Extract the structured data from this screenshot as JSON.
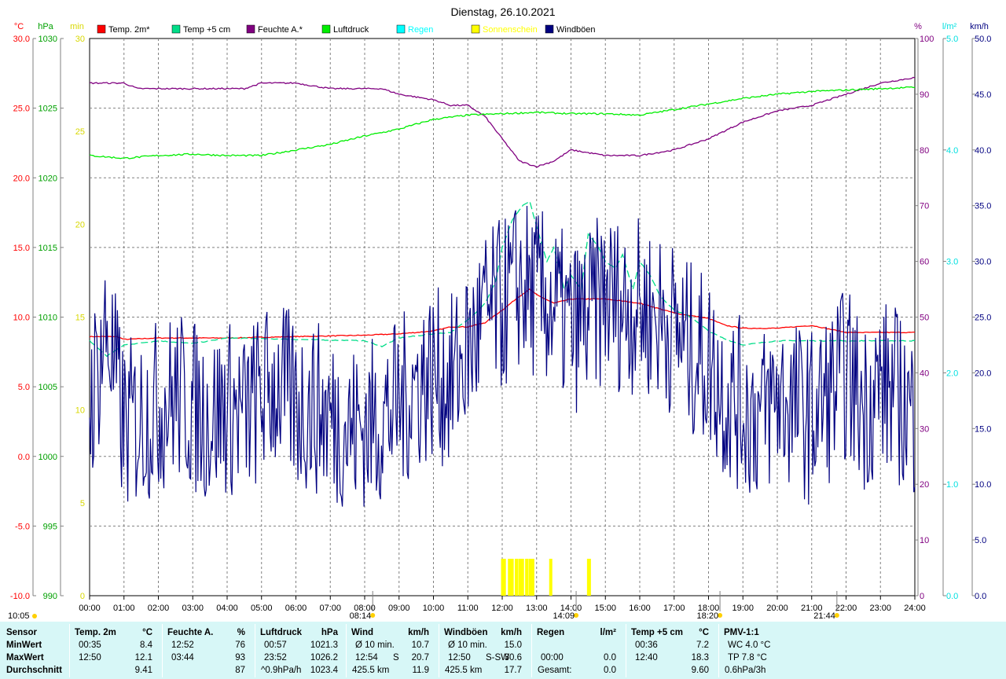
{
  "chart_data": {
    "type": "line",
    "title": "Dienstag, 26.10.2021",
    "x_ticks": [
      "00:00",
      "01:00",
      "02:00",
      "03:00",
      "04:00",
      "05:00",
      "06:00",
      "07:00",
      "08:00",
      "09:00",
      "10:00",
      "11:00",
      "12:00",
      "13:00",
      "14:00",
      "15:00",
      "16:00",
      "17:00",
      "18:00",
      "19:00",
      "20:00",
      "21:00",
      "22:00",
      "23:00",
      "24:00"
    ],
    "xlim": [
      0,
      24
    ],
    "grid": true,
    "legend_position": "top",
    "axes": {
      "temp": {
        "unit": "°C",
        "ylim": [
          -10,
          30
        ],
        "ticks": [
          "30.0",
          "25.0",
          "20.0",
          "15.0",
          "10.0",
          "5.0",
          "0.0",
          "-5.0",
          "-10.0"
        ],
        "color": "#ff0000"
      },
      "pressure": {
        "unit": "hPa",
        "ylim": [
          990,
          1030
        ],
        "ticks": [
          "1030",
          "1025",
          "1020",
          "1015",
          "1010",
          "1005",
          "1000",
          "995",
          "990"
        ],
        "color": "#00a000"
      },
      "sunshine": {
        "unit": "min",
        "ylim": [
          0,
          30
        ],
        "ticks": [
          "30",
          "25",
          "20",
          "15",
          "10",
          "5",
          "0"
        ],
        "color": "#d8d800"
      },
      "humidity": {
        "unit": "%",
        "ylim": [
          0,
          100
        ],
        "ticks": [
          "100",
          "90",
          "80",
          "70",
          "60",
          "50",
          "40",
          "30",
          "20",
          "10",
          "0"
        ],
        "color": "#800080"
      },
      "rain": {
        "unit": "l/m²",
        "ylim": [
          0,
          5
        ],
        "ticks": [
          "5.0",
          "4.0",
          "3.0",
          "2.0",
          "1.0",
          "0.0"
        ],
        "color": "#00e0e0"
      },
      "wind": {
        "unit": "km/h",
        "ylim": [
          0,
          50
        ],
        "ticks": [
          "50.0",
          "45.0",
          "40.0",
          "35.0",
          "30.0",
          "25.0",
          "20.0",
          "15.0",
          "10.0",
          "5.0",
          "0.0"
        ],
        "color": "#000080"
      }
    },
    "series": [
      {
        "name": "Temp. 2m*",
        "color": "#ff0000",
        "axis": "temp",
        "x": [
          0,
          0.8,
          1,
          2,
          4,
          6,
          8,
          9,
          10,
          10.5,
          11,
          11.5,
          12,
          12.5,
          12.8,
          13,
          13.5,
          14,
          15,
          16,
          17,
          17.5,
          18,
          18.5,
          19,
          20,
          21,
          22,
          23,
          24
        ],
        "values": [
          8.6,
          8.6,
          8.4,
          8.5,
          8.5,
          8.6,
          8.7,
          8.8,
          9.0,
          9.3,
          9.3,
          9.6,
          10.5,
          11.5,
          12.0,
          11.6,
          11.0,
          11.3,
          11.3,
          11.0,
          10.3,
          10.1,
          9.9,
          9.4,
          9.2,
          9.2,
          9.4,
          8.9,
          8.9,
          8.9
        ]
      },
      {
        "name": "Temp +5 cm",
        "color": "#00dd88",
        "axis": "temp",
        "dashed": true,
        "x": [
          0,
          0.5,
          1,
          2,
          3,
          4,
          6,
          8,
          8.5,
          9,
          10,
          10.5,
          11,
          11.3,
          11.5,
          11.8,
          12,
          12.3,
          12.6,
          12.8,
          13,
          13.3,
          13.5,
          13.8,
          14,
          14.3,
          14.5,
          14.8,
          15,
          15.3,
          15.5,
          15.8,
          16,
          16.3,
          16.6,
          17,
          17.5,
          18,
          18.5,
          19,
          20,
          21,
          22,
          23,
          24
        ],
        "values": [
          8.3,
          7.2,
          8.0,
          8.3,
          8.1,
          8.5,
          8.4,
          8.3,
          7.9,
          8.5,
          8.8,
          8.9,
          9.8,
          10.5,
          11.0,
          12.5,
          15.0,
          17.0,
          18.0,
          18.3,
          16.5,
          14.0,
          15.0,
          12.0,
          13.0,
          12.0,
          16.0,
          15.0,
          14.0,
          13.5,
          14.5,
          12.0,
          14.0,
          13.0,
          11.5,
          10.5,
          10.0,
          9.0,
          8.4,
          8.0,
          8.3,
          8.3,
          8.3,
          8.3,
          8.3
        ]
      },
      {
        "name": "Feuchte A.*",
        "color": "#800080",
        "axis": "humidity",
        "x": [
          0,
          1,
          1.4,
          3,
          4.5,
          5,
          6,
          7,
          8,
          8.5,
          9,
          10,
          10.5,
          11,
          11.5,
          12,
          12.5,
          13,
          13.5,
          14,
          15,
          16,
          17,
          18,
          19,
          20,
          21,
          22,
          23,
          24
        ],
        "values": [
          92,
          92,
          91,
          91,
          91,
          92,
          92,
          91,
          91,
          91,
          90,
          89,
          88,
          88,
          86,
          82,
          78,
          77,
          78,
          80,
          79,
          79,
          80,
          82,
          85,
          87,
          88,
          90,
          92,
          93
        ]
      },
      {
        "name": "Luftdruck",
        "color": "#00ee00",
        "axis": "pressure",
        "x": [
          0,
          1,
          2,
          3,
          4,
          5,
          6,
          7,
          8,
          9,
          10,
          11,
          12,
          13,
          14,
          15,
          16,
          17,
          18,
          19,
          20,
          21,
          22,
          23,
          24
        ],
        "values": [
          1021.6,
          1021.4,
          1021.6,
          1021.7,
          1021.6,
          1021.6,
          1022.0,
          1022.4,
          1023.0,
          1023.5,
          1024.2,
          1024.5,
          1024.6,
          1024.7,
          1024.6,
          1024.6,
          1024.5,
          1024.9,
          1025.3,
          1025.7,
          1026.0,
          1026.2,
          1026.3,
          1026.4,
          1026.5
        ]
      },
      {
        "name": "Regen",
        "color": "#00ffff",
        "axis": "rain",
        "x": [
          0,
          24
        ],
        "values": [
          0,
          0
        ]
      },
      {
        "name": "Sonnenschein",
        "color": "#ffff00",
        "axis": "sunshine",
        "x": [
          12.0,
          12.05,
          12.2,
          12.3,
          12.4,
          12.5,
          12.6,
          12.7,
          12.8,
          12.9,
          13.4,
          14.5
        ],
        "values": [
          2,
          2,
          2,
          2,
          2,
          2,
          2,
          2,
          2,
          2,
          2,
          2
        ]
      },
      {
        "name": "Windböen",
        "color": "#000080",
        "axis": "wind",
        "x": [
          0,
          0.5,
          1,
          1.5,
          2,
          2.5,
          3,
          3.5,
          4,
          4.5,
          5,
          5.5,
          6,
          6.5,
          7,
          7.5,
          8,
          8.5,
          9,
          9.5,
          10,
          10.5,
          11,
          11.5,
          12,
          12.5,
          13,
          13.5,
          14,
          14.5,
          15,
          15.5,
          16,
          16.5,
          17,
          17.5,
          18,
          18.5,
          19,
          19.5,
          20,
          20.5,
          21,
          21.5,
          22,
          22.5,
          23,
          23.5,
          24
        ],
        "values": [
          17,
          24,
          15,
          16,
          17,
          18,
          17,
          16,
          17,
          16,
          18,
          19,
          17,
          17,
          16,
          15,
          15,
          16,
          17,
          19,
          20,
          19,
          22,
          25,
          26,
          28,
          27,
          26,
          24,
          25,
          27,
          26,
          26,
          25,
          24,
          22,
          21,
          18,
          17,
          16,
          18,
          17,
          16,
          18,
          20,
          17,
          19,
          18,
          16
        ]
      }
    ],
    "annotations": [
      {
        "time": "08:14",
        "label": "08:14",
        "meaning": "sunrise"
      },
      {
        "time": "14:09",
        "label": "14:09"
      },
      {
        "time": "18:20",
        "label": "18:20",
        "meaning": "sunset"
      },
      {
        "time": "21:44",
        "label": "21:44"
      }
    ],
    "footer_time": "10:05"
  },
  "summary": {
    "row_labels": {
      "title": "Sensor",
      "min": "MinWert",
      "max": "MaxWert",
      "avg": "Durchschnitt"
    },
    "columns": [
      {
        "head": "Temp. 2m",
        "unit": "°C",
        "min_time": "00:35",
        "min_val": "8.4",
        "max_time": "12:50",
        "max_val": "12.1",
        "avg_pre": "",
        "avg_val": "9.41"
      },
      {
        "head": "Feuchte A.",
        "unit": "%",
        "min_time": "12:52",
        "min_val": "76",
        "max_time": "03:44",
        "max_val": "93",
        "avg_pre": "",
        "avg_val": "87"
      },
      {
        "head": "Luftdruck",
        "unit": "hPa",
        "min_time": "00:57",
        "min_val": "1021.3",
        "max_time": "23:52",
        "max_val": "1026.2",
        "avg_pre": "^0.9hPa/h",
        "avg_val": "1023.4"
      },
      {
        "head": "Wind",
        "unit": "km/h",
        "min_time": "Ø 10 min.",
        "min_val": "10.7",
        "max_time": "12:54",
        "max_mid": "S",
        "max_val": "20.7",
        "avg_pre": "425.5 km",
        "avg_val": "11.9"
      },
      {
        "head": "Windböen",
        "unit": "km/h",
        "min_time": "Ø 10 min.",
        "min_val": "15.0",
        "max_time": "12:50",
        "max_mid": "S-SW",
        "max_val": "30.6",
        "avg_pre": "425.5 km",
        "avg_val": "17.7"
      },
      {
        "head": "Regen",
        "unit": "l/m²",
        "min_time": "",
        "min_val": "",
        "max_time": "00:00",
        "max_val": "0.0",
        "avg_pre": "Gesamt:",
        "avg_val": "0.0"
      },
      {
        "head": "Temp +5 cm",
        "unit": "°C",
        "min_time": "00:36",
        "min_val": "7.2",
        "max_time": "12:40",
        "max_val": "18.3",
        "avg_pre": "",
        "avg_val": "9.60"
      },
      {
        "head": "PMV-1:1",
        "unit": "",
        "min_time": "WC 4.0 °C",
        "min_val": "",
        "max_time": "TP 7.8 °C",
        "max_val": "",
        "avg_pre": "0.6hPa/3h",
        "avg_val": ""
      }
    ]
  }
}
